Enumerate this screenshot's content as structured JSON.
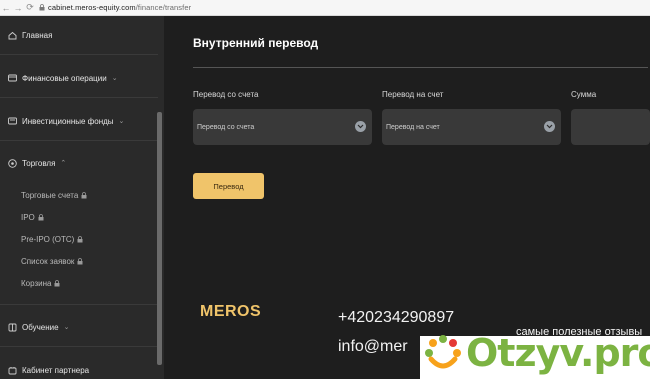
{
  "browser": {
    "back_icon": "arrow-left-icon",
    "forward_icon": "arrow-right-icon",
    "reload_icon": "reload-icon",
    "url_domain": "cabinet.meros-equity.com",
    "url_path": "/finance/transfer"
  },
  "sidebar": {
    "items": [
      {
        "label": "Главная",
        "icon": "home-icon"
      },
      {
        "label": "Финансовые операции",
        "icon": "wallet-icon"
      },
      {
        "label": "Инвестиционные фонды",
        "icon": "fund-icon"
      },
      {
        "label": "Торговля",
        "icon": "trade-icon"
      },
      {
        "label": "Обучение",
        "icon": "book-icon"
      },
      {
        "label": "Кабинет партнера",
        "icon": "partner-icon"
      }
    ],
    "sub_items": [
      {
        "label": "Торговые счета"
      },
      {
        "label": "IPO"
      },
      {
        "label": "Pre-IPO (OTC)"
      },
      {
        "label": "Список заявок"
      },
      {
        "label": "Корзина"
      }
    ]
  },
  "main": {
    "title": "Внутренний перевод",
    "from_label": "Перевод со счета",
    "to_label": "Перевод на счет",
    "amount_label": "Сумма",
    "from_placeholder": "Перевод со счета",
    "to_placeholder": "Перевод на счет",
    "amount_value": "",
    "submit_label": "Перевод"
  },
  "footer": {
    "brand": "MEROS",
    "phone": "+420234290897",
    "email": "info@mer"
  },
  "watermark": {
    "tagline": "самые полезные отзывы",
    "brand": "Otzyv.pro"
  },
  "colors": {
    "accent": "#f0c46a",
    "sidebar_bg": "#2a2a2a",
    "main_bg": "#1e1e1e",
    "field_bg": "#393939",
    "watermark_green": "#7cb342"
  }
}
